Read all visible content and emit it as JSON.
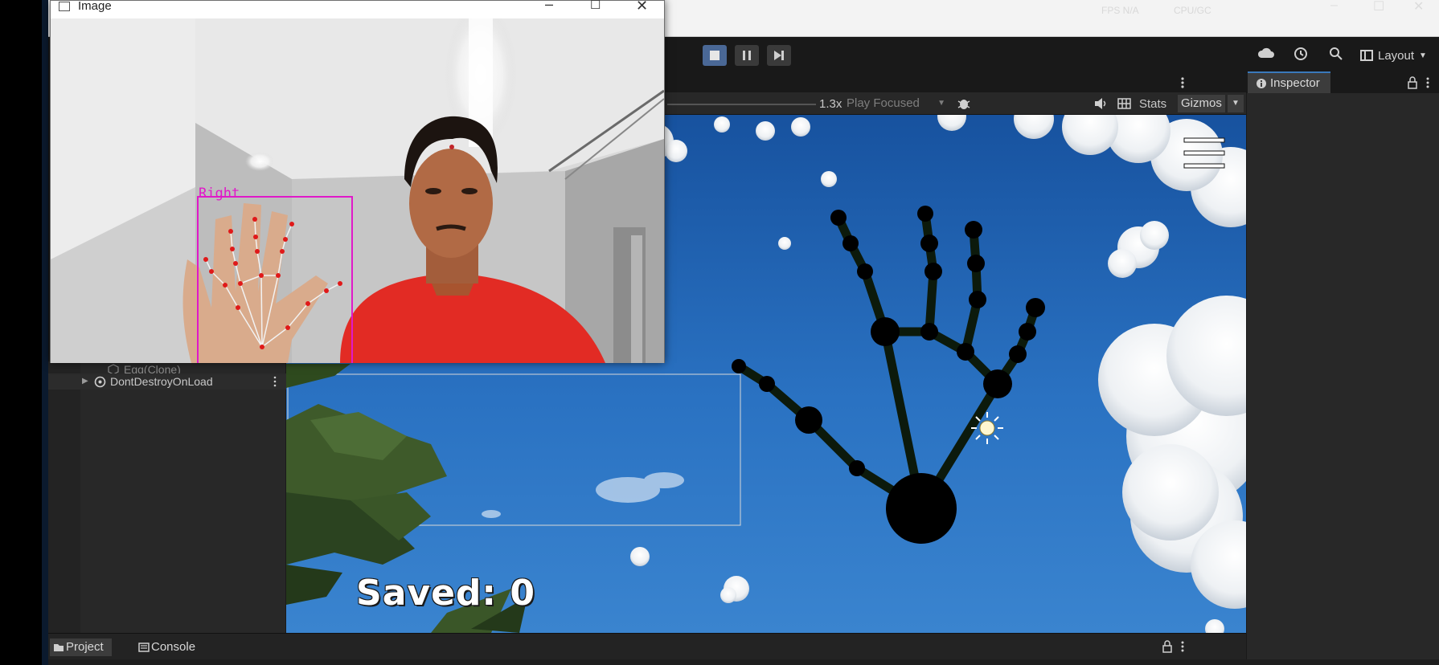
{
  "camera_window": {
    "title": "Image",
    "hand_label": "Right",
    "controls": [
      "minimize",
      "maximize",
      "close"
    ]
  },
  "editor": {
    "title_strip": {
      "right_text_a": "FPS N/A",
      "right_text_b": "CPU/GC"
    },
    "toolbar": {
      "layout_label": "Layout",
      "play_state": "playing",
      "icons": [
        "cloud-icon",
        "history-icon",
        "search-icon",
        "layout-icon"
      ]
    },
    "game_view": {
      "scale_label": "1.3x",
      "play_mode": "Play Focused",
      "stats_label": "Stats",
      "gizmos_label": "Gizmos",
      "hud_text": "Saved: 0"
    },
    "inspector": {
      "tab_label": "Inspector"
    },
    "hierarchy": {
      "items": [
        {
          "label": "Egg(Clone)"
        },
        {
          "label": "DontDestroyOnLoad"
        }
      ]
    },
    "bottom_tabs": [
      {
        "label": "Project"
      },
      {
        "label": "Console"
      }
    ]
  },
  "colors": {
    "accent": "#3a79bb",
    "play_active": "#4a6896",
    "landmark_pink": "#e019c9",
    "sky": "#2a72c2"
  }
}
